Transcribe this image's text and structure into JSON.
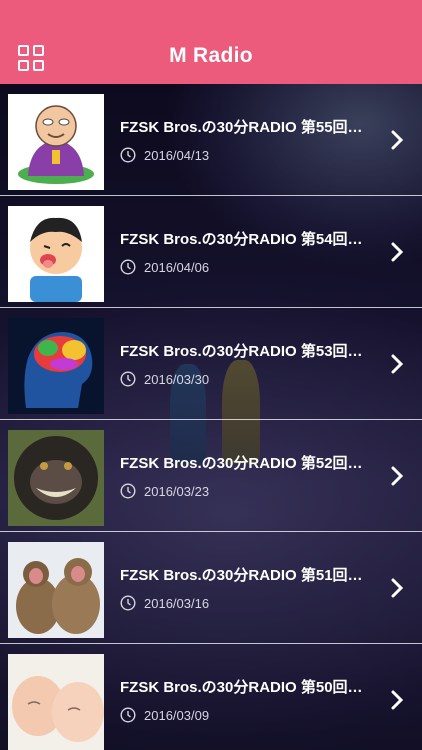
{
  "header": {
    "title": "M Radio",
    "menu_icon": "grid-menu-icon",
    "bg_color": "#ec5b7c"
  },
  "episodes": [
    {
      "title": "FZSK Bros.の30分RADIO 第55回…",
      "date": "2016/04/13",
      "thumb": "bald-old-man-illustration"
    },
    {
      "title": "FZSK Bros.の30分RADIO 第54回…",
      "date": "2016/04/06",
      "thumb": "boy-tongue-out-illustration"
    },
    {
      "title": "FZSK Bros.の30分RADIO 第53回…",
      "date": "2016/03/30",
      "thumb": "brain-head-illustration"
    },
    {
      "title": "FZSK Bros.の30分RADIO 第52回…",
      "date": "2016/03/23",
      "thumb": "smiling-monkey-photo"
    },
    {
      "title": "FZSK Bros.の30分RADIO 第51回…",
      "date": "2016/03/16",
      "thumb": "snow-monkeys-photo"
    },
    {
      "title": "FZSK Bros.の30分RADIO 第50回…",
      "date": "2016/03/09",
      "thumb": "babies-photo"
    }
  ],
  "icons": {
    "date": "clock-icon",
    "open": "chevron-right-icon"
  }
}
